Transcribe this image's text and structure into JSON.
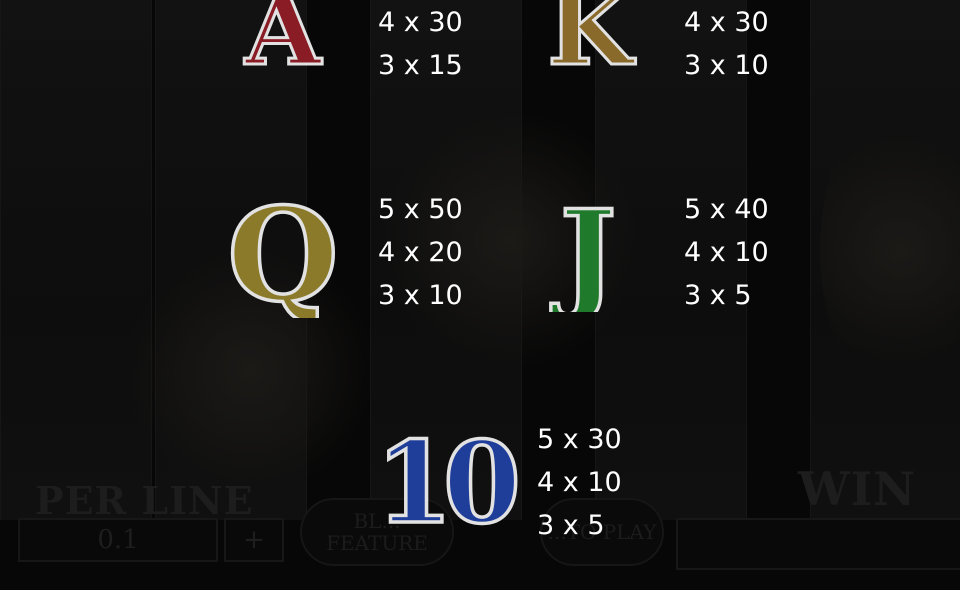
{
  "paytable": {
    "symbols": [
      {
        "id": "A",
        "glyph": "A",
        "icon": "letter-a-symbol-icon",
        "payouts": [
          "4 x 30",
          "3 x 15"
        ]
      },
      {
        "id": "K",
        "glyph": "K",
        "icon": "letter-k-symbol-icon",
        "payouts": [
          "4 x 30",
          "3 x 10"
        ]
      },
      {
        "id": "Q",
        "glyph": "Q",
        "icon": "letter-q-symbol-icon",
        "payouts": [
          "5 x 50",
          "4 x 20",
          "3 x 10"
        ]
      },
      {
        "id": "J",
        "glyph": "J",
        "icon": "letter-j-symbol-icon",
        "payouts": [
          "5 x 40",
          "4 x 10",
          "3 x 5"
        ]
      },
      {
        "id": "10",
        "glyph": "10",
        "icon": "number-10-symbol-icon",
        "payouts": [
          "5 x 30",
          "4 x 10",
          "3 x 5"
        ]
      }
    ]
  },
  "background_controls": {
    "per_line_label": "PER LINE",
    "per_line_value": "0.1",
    "plus_label": "+",
    "blitz_feature_label": "BL... FEATURE",
    "auto_play_label": "...TO PLAY",
    "win_label": "WIN"
  },
  "colors": {
    "A": "#8a1c25",
    "K": "#8a6a2a",
    "Q": "#8a7a2a",
    "J": "#1f7a2b",
    "ten": "#1f3e9a",
    "silver": "#d8d8d8",
    "text": "#ffffff",
    "background": "#070707"
  }
}
